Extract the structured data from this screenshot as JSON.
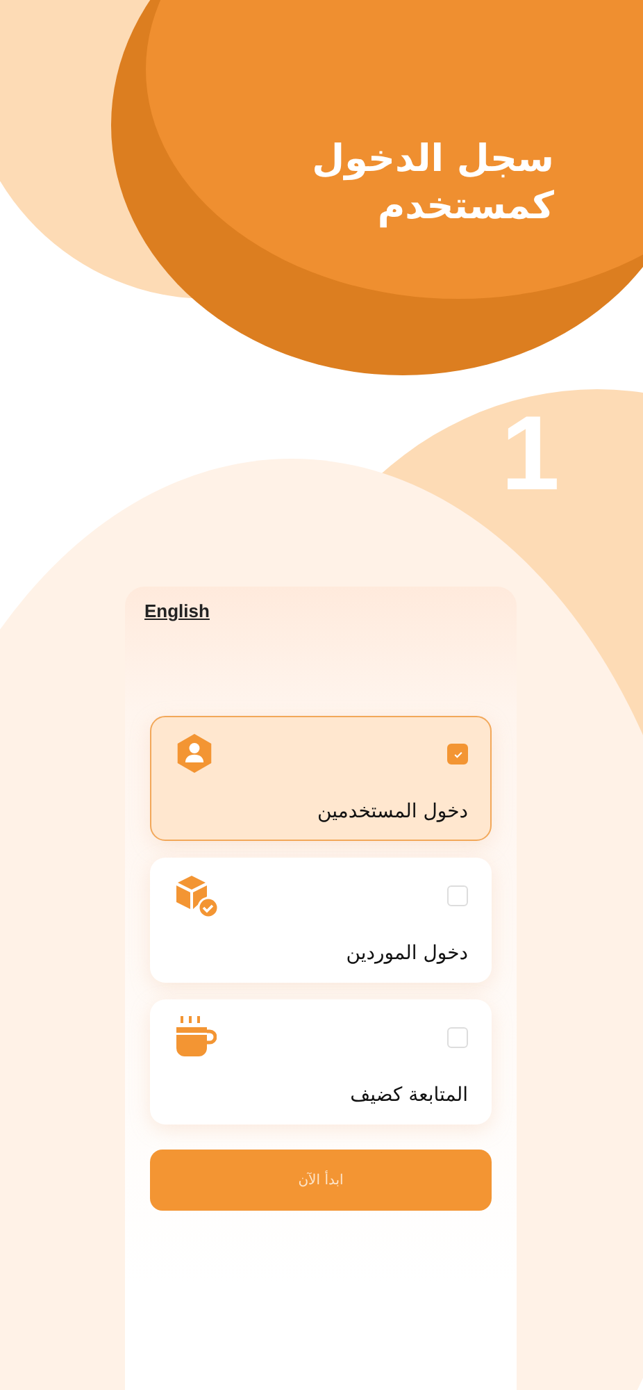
{
  "header": {
    "title": "سجل الدخول كمستخدم",
    "step": "1"
  },
  "panel": {
    "language_link": "English",
    "options": [
      {
        "kind": "user",
        "label": "دخول المستخدمين",
        "selected": true
      },
      {
        "kind": "supplier",
        "label": "دخول الموردين",
        "selected": false
      },
      {
        "kind": "guest",
        "label": "المتابعة كضيف",
        "selected": false
      }
    ],
    "start_button": "ابدأ الآن"
  }
}
